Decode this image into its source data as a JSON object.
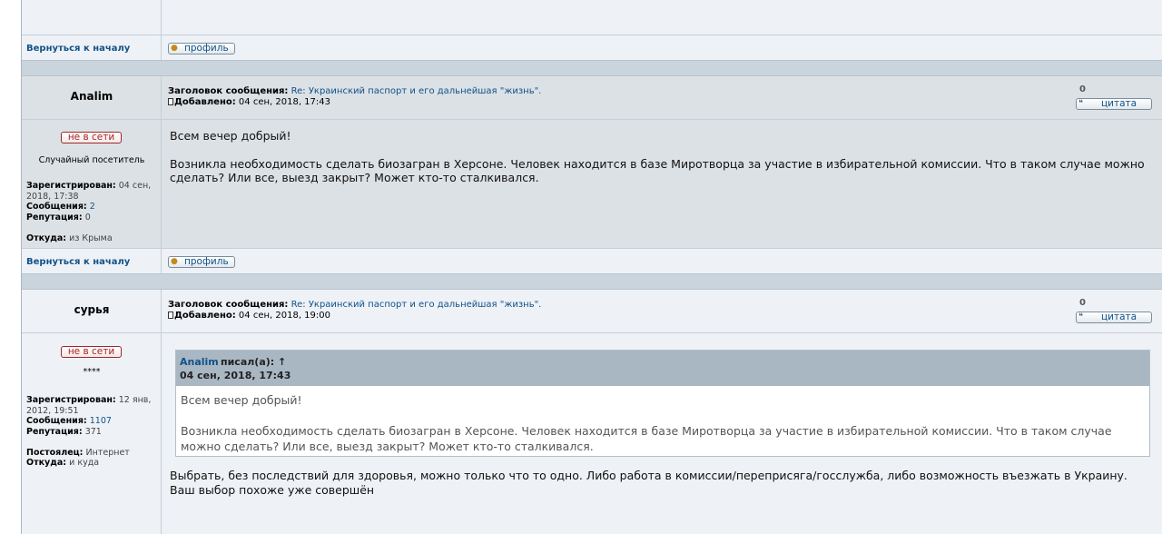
{
  "common": {
    "back_to_top": "Вернуться к началу",
    "profile_button": "профиль",
    "quote_button": "цитата",
    "subject_label": "Заголовок сообщения:",
    "added_label": "Добавлено:",
    "registered_label": "Зарегистрирован:",
    "posts_label": "Сообщения:",
    "reputation_label": "Репутация:",
    "from_label": "Откуда:",
    "regular_label": "Постоялец:",
    "online_status": "не в сети"
  },
  "posts": [
    {
      "author": "Analim",
      "subject": "Re: Украинский паспорт и его дальнейшая \"жизнь\".",
      "added": "04 сен, 2018, 17:43",
      "rank_count": "0",
      "user_rank": "Случайный посетитель",
      "registered": "04 сен, 2018, 17:38",
      "posts_count": "2",
      "reputation": "0",
      "from": "из Крыма",
      "message_line1": "Всем вечер добрый!",
      "message_line2": "Возникла необходимость сделать биозагран в Херсоне. Человек находится в базе Миротворца за участие в избирательной комиссии. Что в таком случае можно сделать? Или все, выезд закрыт? Может кто-то сталкивался."
    },
    {
      "author": "сурья",
      "subject": "Re: Украинский паспорт и его дальнейшая \"жизнь\".",
      "added": "04 сен, 2018, 19:00",
      "rank_count": "0",
      "user_rank": "****",
      "registered": "12 янв, 2012, 19:51",
      "posts_count": "1107",
      "reputation": "371",
      "regular": "Интернет",
      "from": "и куда",
      "quote": {
        "author": "Analim",
        "wrote": "писал(а): ↑",
        "date": "04 сен, 2018, 17:43",
        "line1": "Всем вечер добрый!",
        "line2": "Возникла необходимость сделать биозагран в Херсоне. Человек находится в базе Миротворца за участие в избирательной комиссии. Что в таком случае можно сделать? Или все, выезд закрыт? Может кто-то сталкивался."
      },
      "message": "Выбрать, без последствий для здоровья, можно только что то одно. Либо работа в комиссии/перeприсяга/госслужба, либо возможность въезжать в Украину. Ваш выбор похоже уже совершён"
    }
  ]
}
